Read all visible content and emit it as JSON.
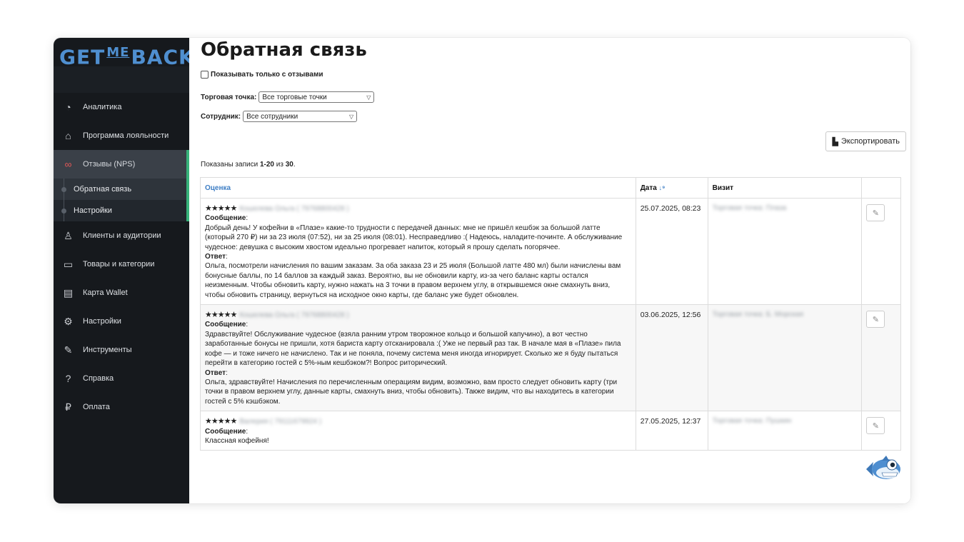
{
  "brand": {
    "logo_left": "GET",
    "logo_me": "ME",
    "logo_right": "BACK"
  },
  "sidebar": {
    "items": [
      {
        "label": "Аналитика",
        "icon": "analytics-icon",
        "glyph": "◔"
      },
      {
        "label": "Программа лояльности",
        "icon": "home-icon",
        "glyph": "⌂"
      },
      {
        "label": "Отзывы (NPS)",
        "icon": "reviews-icon",
        "glyph": "∞",
        "active": true
      },
      {
        "label": "Клиенты и аудитории",
        "icon": "clients-icon",
        "glyph": "♙"
      },
      {
        "label": "Товары и категории",
        "icon": "catalog-icon",
        "glyph": "▭"
      },
      {
        "label": "Карта Wallet",
        "icon": "wallet-icon",
        "glyph": "▤"
      },
      {
        "label": "Настройки",
        "icon": "settings-icon",
        "glyph": "⚙"
      },
      {
        "label": "Инструменты",
        "icon": "tools-icon",
        "glyph": "✎"
      },
      {
        "label": "Справка",
        "icon": "help-icon",
        "glyph": "?"
      },
      {
        "label": "Оплата",
        "icon": "payment-icon",
        "glyph": "₽"
      }
    ],
    "subitems": [
      {
        "label": "Обратная связь"
      },
      {
        "label": "Настройки"
      }
    ]
  },
  "main": {
    "title": "Обратная связь",
    "only_with_reviews_label": "Показывать только с отзывами",
    "outlet_label": "Торговая точка:",
    "outlet_value": "Все торговые точки",
    "employee_label": "Сотрудник:",
    "employee_value": "Все сотрудники",
    "export_label": "Экспортировать",
    "records_prefix": "Показаны записи ",
    "records_range": "1-20",
    "records_mid": " из ",
    "records_total": "30",
    "records_suffix": "."
  },
  "table": {
    "headers": {
      "score": "Оценка",
      "date": "Дата",
      "sort_icon": "↓⁹",
      "visit": "Визит"
    },
    "rows": [
      {
        "stars": "★★★★★",
        "author": "Кошелева Ольга ( 79768800428 )",
        "message_label": "Сообщение",
        "message": "Добрый день! У кофейни в «Плазе» какие-то трудности с передачей данных: мне не пришёл кешбэк за большой латте (который 270 ₽) ни за 23 июля (07:52), ни за 25 июля (08:01). Несправедливо :( Надеюсь, наладите-починте. А обслуживание чудесное: девушка с высоким хвостом идеально прогревает напиток, который я прошу сделать погорячее.",
        "answer_label": "Ответ",
        "answer": "Ольга, посмотрели начисления по вашим заказам. За оба заказа 23 и 25 июля (Большой латте 480 мл) были начислены вам бонусные баллы, по 14 баллов за каждый заказ. Вероятно, вы не обновили карту, из-за чего баланс карты остался неизменным. Чтобы обновить карту, нужно нажать на 3 точки в правом верхнем углу, в открывшемся окне смахнуть вниз, чтобы обновить страницу, вернуться на исходное окно карты, где баланс уже будет обновлен.",
        "date": "25.07.2025, 08:23",
        "visit": "Торговая точка: Плаза"
      },
      {
        "stars": "★★★★★",
        "author": "Кошелева Ольга ( 79768800428 )",
        "message_label": "Сообщение",
        "message": "Здравствуйте! Обслуживание чудесное (взяла ранним утром творожное кольцо и большой капучино), а вот честно заработанные бонусы не пришли, хотя бариста карту отсканировала :( Уже не первый раз так. В начале мая в «Плазе» пила кофе — и тоже ничего не начислено. Так и не поняла, почему система меня иногда игнорирует. Сколько же я буду пытаться перейти в категорию гостей с 5%-ным кешбэком?! Вопрос риторический.",
        "answer_label": "Ответ",
        "answer": "Ольга, здравствуйте! Начисления по перечисленным операциям видим, возможно, вам просто следует обновить карту (три точки в правом верхнем углу, данные карты, смахнуть вниз, чтобы обновить). Также видим, что вы находитесь в категории гостей с 5% кэшбэком.",
        "date": "03.06.2025, 12:56",
        "visit": "Торговая точка: Б. Морская"
      },
      {
        "stars": "★★★★★",
        "author": "Валерия ( 79111679924 )",
        "message_label": "Сообщение",
        "message": "Классная кофейня!",
        "answer_label": "",
        "answer": "",
        "date": "27.05.2025, 12:37",
        "visit": "Торговая точка: Пушкин"
      }
    ]
  }
}
